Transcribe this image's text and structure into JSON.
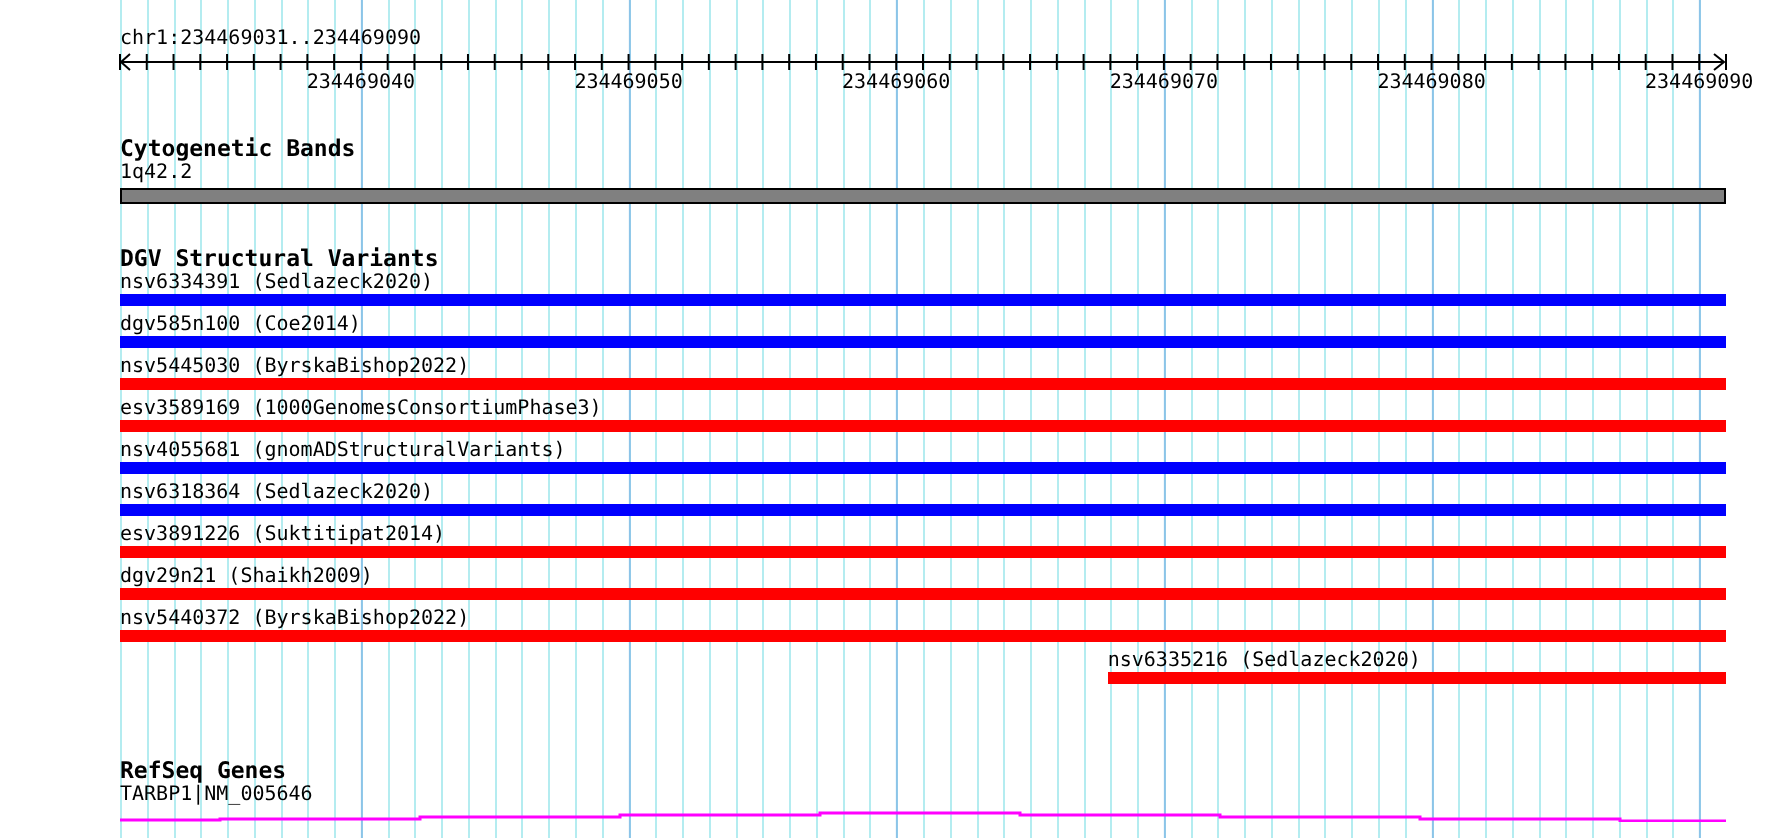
{
  "ruler": {
    "location": "chr1:234469031..234469090",
    "tick_labels": [
      "234469040",
      "234469050",
      "234469060",
      "234469070",
      "234469080",
      "234469090"
    ]
  },
  "cytogenetic_bands": {
    "title": "Cytogenetic Bands",
    "band": "1q42.2"
  },
  "dgv_structural_variants": {
    "title": "DGV Structural Variants",
    "variants": [
      {
        "label": "nsv6334391 (Sedlazeck2020)",
        "color": "#0000ff",
        "level": 1
      },
      {
        "label": "dgv585n100 (Coe2014)",
        "color": "#0000ff",
        "level": 1
      },
      {
        "label": "nsv5445030 (ByrskaBishop2022)",
        "color": "#ff0000",
        "level": 1
      },
      {
        "label": "esv3589169 (1000GenomesConsortiumPhase3)",
        "color": "#ff0000",
        "level": 1
      },
      {
        "label": "nsv4055681 (gnomADStructuralVariants)",
        "color": "#0000ff",
        "level": 1
      },
      {
        "label": "nsv6318364 (Sedlazeck2020)",
        "color": "#0000ff",
        "level": 1
      },
      {
        "label": "esv3891226 (Suktitipat2014)",
        "color": "#ff0000",
        "level": 1
      },
      {
        "label": "dgv29n21 (Shaikh2009)",
        "color": "#ff0000",
        "level": 1
      },
      {
        "label": "nsv5440372 (ByrskaBishop2022)",
        "color": "#ff0000",
        "level": 1
      },
      {
        "label": "nsv6335216 (Sedlazeck2020)",
        "color": "#ff0000",
        "level": 0.385
      }
    ]
  },
  "refseq_genes": {
    "title": "RefSeq Genes",
    "gene": "TARBP1|NM_005646"
  }
}
